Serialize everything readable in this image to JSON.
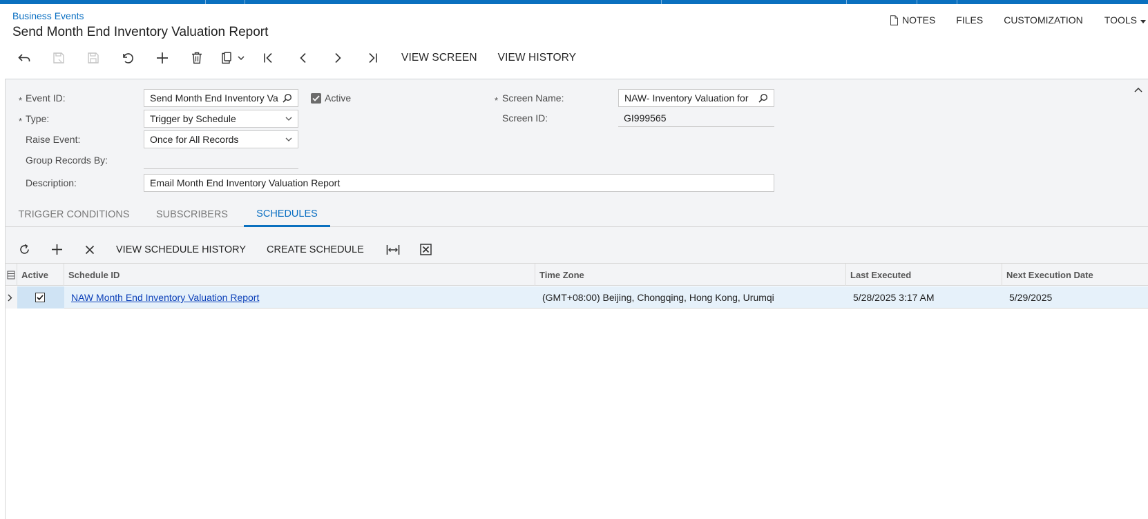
{
  "breadcrumb": "Business Events",
  "title": "Send Month End Inventory Valuation Report",
  "top_menu": {
    "notes": "NOTES",
    "files": "FILES",
    "customization": "CUSTOMIZATION",
    "tools": "TOOLS"
  },
  "toolbar": {
    "view_screen": "VIEW SCREEN",
    "view_history": "VIEW HISTORY"
  },
  "form": {
    "event_id_label": "Event ID:",
    "event_id_value": "Send Month End Inventory Va",
    "active_label": "Active",
    "active_checked": true,
    "type_label": "Type:",
    "type_value": "Trigger by Schedule",
    "raise_event_label": "Raise Event:",
    "raise_event_value": "Once for All Records",
    "group_records_label": "Group Records By:",
    "group_records_value": "",
    "description_label": "Description:",
    "description_value": "Email Month End Inventory Valuation Report",
    "screen_name_label": "Screen Name:",
    "screen_name_value": "NAW- Inventory Valuation for",
    "screen_id_label": "Screen ID:",
    "screen_id_value": "GI999565",
    "required_mark": "*"
  },
  "tabs": [
    "TRIGGER CONDITIONS",
    "SUBSCRIBERS",
    "SCHEDULES"
  ],
  "active_tab": "SCHEDULES",
  "grid_toolbar": {
    "view_schedule_history": "VIEW SCHEDULE HISTORY",
    "create_schedule": "CREATE SCHEDULE"
  },
  "grid": {
    "columns": [
      "Active",
      "Schedule ID",
      "Time Zone",
      "Last Executed",
      "Next Execution Date"
    ],
    "rows": [
      {
        "active": true,
        "schedule_id": "NAW Month End Inventory Valuation Report",
        "time_zone": "(GMT+08:00) Beijing, Chongqing, Hong Kong, Urumqi",
        "last_executed": "5/28/2025 3:17 AM",
        "next_execution_date": "5/29/2025"
      }
    ]
  },
  "colors": {
    "accent": "#0a70bf",
    "link": "#0a3fb8",
    "selected_row": "#e6f1fa"
  }
}
